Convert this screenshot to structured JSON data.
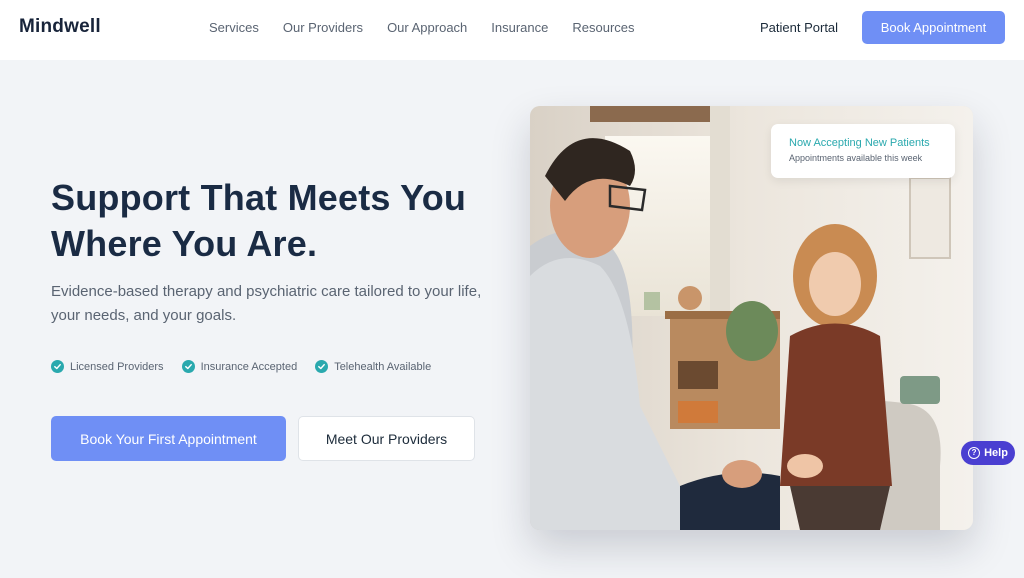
{
  "header": {
    "logo": "Mindwell",
    "nav": [
      "Services",
      "Our Providers",
      "Our Approach",
      "Insurance",
      "Resources"
    ],
    "portal_label": "Patient Portal",
    "book_label": "Book Appointment"
  },
  "hero": {
    "headline": "Support That Meets You Where You Are.",
    "subtext": "Evidence-based therapy and psychiatric care tailored to your life, your needs, and your goals.",
    "features": [
      "Licensed Providers",
      "Insurance Accepted",
      "Telehealth Available"
    ],
    "cta_primary": "Book Your First Appointment",
    "cta_secondary": "Meet Our Providers"
  },
  "badge": {
    "title": "Now Accepting New Patients",
    "subtitle": "Appointments available this week"
  },
  "help": {
    "label": "Help",
    "icon": "question-icon"
  },
  "colors": {
    "accent": "#6f8ff5",
    "teal": "#2aa9ae",
    "help": "#4a3fd1",
    "headline": "#1a2b44"
  }
}
